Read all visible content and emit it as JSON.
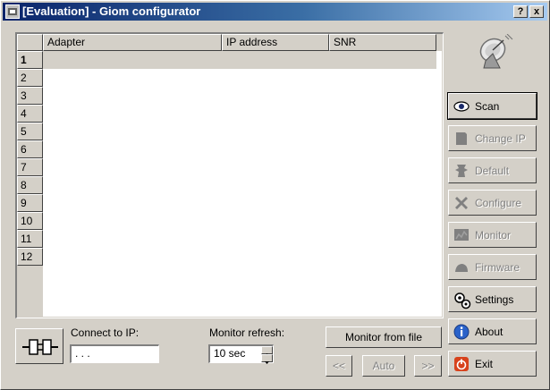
{
  "window": {
    "title": "[Evaluation] - Giom configurator",
    "help_button": "?",
    "close_button": "x"
  },
  "grid": {
    "columns": [
      "Adapter",
      "IP address",
      "SNR"
    ],
    "rows": [
      "1",
      "2",
      "3",
      "4",
      "5",
      "6",
      "7",
      "8",
      "9",
      "10",
      "11",
      "12"
    ]
  },
  "sidebar": {
    "buttons": [
      {
        "label": "Scan",
        "icon": "eye-icon",
        "enabled": true
      },
      {
        "label": "Change IP",
        "icon": "change-ip-icon",
        "enabled": false
      },
      {
        "label": "Default",
        "icon": "default-icon",
        "enabled": false
      },
      {
        "label": "Configure",
        "icon": "tools-icon",
        "enabled": false
      },
      {
        "label": "Monitor",
        "icon": "monitor-icon",
        "enabled": false
      },
      {
        "label": "Firmware",
        "icon": "firmware-icon",
        "enabled": false
      },
      {
        "label": "Settings",
        "icon": "gears-icon",
        "enabled": true
      },
      {
        "label": "About",
        "icon": "info-icon",
        "enabled": true
      },
      {
        "label": "Exit",
        "icon": "power-icon",
        "enabled": true
      }
    ]
  },
  "bottom": {
    "connect_label": "Connect to IP:",
    "ip_value": " .   .   . ",
    "monitor_refresh_label": "Monitor refresh:",
    "refresh_value": "10 sec",
    "monitor_from_file": "Monitor from file",
    "prev": "<<",
    "auto": "Auto",
    "next": ">>"
  },
  "colors": {
    "title_start": "#0a246a",
    "title_end": "#a6caf0",
    "face": "#d4d0c8",
    "about_blue": "#2a62c9",
    "exit_red": "#d7421c"
  }
}
